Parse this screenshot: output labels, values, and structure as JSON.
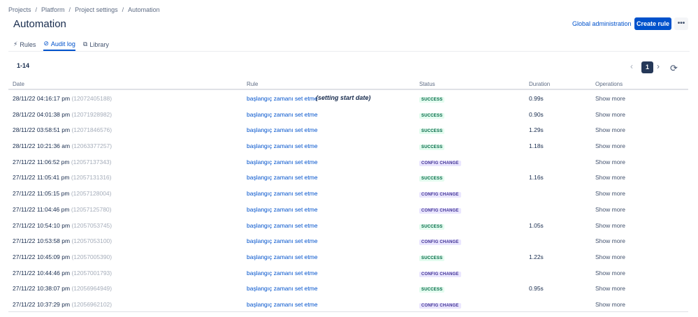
{
  "breadcrumb": [
    "Projects",
    "Platform",
    "Project settings",
    "Automation"
  ],
  "page_title": "Automation",
  "header": {
    "global_admin_label": "Global administration",
    "create_rule_label": "Create rule",
    "more_label": "•••"
  },
  "tabs": [
    {
      "label": "Rules",
      "icon": "lightning-icon",
      "glyph": "⚡",
      "active": false
    },
    {
      "label": "Audit log",
      "icon": "check-circle-icon",
      "glyph": "⊘",
      "active": true
    },
    {
      "label": "Library",
      "icon": "copy-icon",
      "glyph": "⧉",
      "active": false
    }
  ],
  "range_label": "1-14",
  "pagination": {
    "current_page": "1",
    "prev_glyph": "‹",
    "next_glyph": "›",
    "refresh_glyph": "⟳"
  },
  "columns": {
    "date": "Date",
    "rule": "Rule",
    "status": "Status",
    "duration": "Duration",
    "operations": "Operations"
  },
  "annotation": "(setting start date)",
  "rows": [
    {
      "date": "28/11/22 04:16:17 pm",
      "id": "(12072405188)",
      "rule": "başlangıç zamanı set etme",
      "status": "SUCCESS",
      "status_type": "success",
      "duration": "0.99s",
      "ops": "Show more"
    },
    {
      "date": "28/11/22 04:01:38 pm",
      "id": "(12071928982)",
      "rule": "başlangıç zamanı set etme",
      "status": "SUCCESS",
      "status_type": "success",
      "duration": "0.90s",
      "ops": "Show more"
    },
    {
      "date": "28/11/22 03:58:51 pm",
      "id": "(12071846576)",
      "rule": "başlangıç zamanı set etme",
      "status": "SUCCESS",
      "status_type": "success",
      "duration": "1.29s",
      "ops": "Show more"
    },
    {
      "date": "28/11/22 10:21:36 am",
      "id": "(12063377257)",
      "rule": "başlangıç zamanı set etme",
      "status": "SUCCESS",
      "status_type": "success",
      "duration": "1.18s",
      "ops": "Show more"
    },
    {
      "date": "27/11/22 11:06:52 pm",
      "id": "(12057137343)",
      "rule": "başlangıç zamanı set etme",
      "status": "CONFIG CHANGE",
      "status_type": "config",
      "duration": "",
      "ops": "Show more"
    },
    {
      "date": "27/11/22 11:05:41 pm",
      "id": "(12057131316)",
      "rule": "başlangıç zamanı set etme",
      "status": "SUCCESS",
      "status_type": "success",
      "duration": "1.16s",
      "ops": "Show more"
    },
    {
      "date": "27/11/22 11:05:15 pm",
      "id": "(12057128004)",
      "rule": "başlangıç zamanı set etme",
      "status": "CONFIG CHANGE",
      "status_type": "config",
      "duration": "",
      "ops": "Show more"
    },
    {
      "date": "27/11/22 11:04:46 pm",
      "id": "(12057125780)",
      "rule": "başlangıç zamanı set etme",
      "status": "CONFIG CHANGE",
      "status_type": "config",
      "duration": "",
      "ops": "Show more"
    },
    {
      "date": "27/11/22 10:54:10 pm",
      "id": "(12057053745)",
      "rule": "başlangıç zamanı set etme",
      "status": "SUCCESS",
      "status_type": "success",
      "duration": "1.05s",
      "ops": "Show more"
    },
    {
      "date": "27/11/22 10:53:58 pm",
      "id": "(12057053100)",
      "rule": "başlangıç zamanı set etme",
      "status": "CONFIG CHANGE",
      "status_type": "config",
      "duration": "",
      "ops": "Show more"
    },
    {
      "date": "27/11/22 10:45:09 pm",
      "id": "(12057005390)",
      "rule": "başlangıç zamanı set etme",
      "status": "SUCCESS",
      "status_type": "success",
      "duration": "1.22s",
      "ops": "Show more"
    },
    {
      "date": "27/11/22 10:44:46 pm",
      "id": "(12057001793)",
      "rule": "başlangıç zamanı set etme",
      "status": "CONFIG CHANGE",
      "status_type": "config",
      "duration": "",
      "ops": "Show more"
    },
    {
      "date": "27/11/22 10:38:07 pm",
      "id": "(12056964949)",
      "rule": "başlangıç zamanı set etme",
      "status": "SUCCESS",
      "status_type": "success",
      "duration": "0.95s",
      "ops": "Show more"
    },
    {
      "date": "27/11/22 10:37:29 pm",
      "id": "(12056962102)",
      "rule": "başlangıç zamanı set etme",
      "status": "CONFIG CHANGE",
      "status_type": "config",
      "duration": "",
      "ops": "Show more"
    }
  ],
  "colors": {
    "primary": "#0052cc",
    "success_bg": "#e3fcef",
    "success_fg": "#006644",
    "config_bg": "#eae6ff",
    "config_fg": "#403294"
  }
}
